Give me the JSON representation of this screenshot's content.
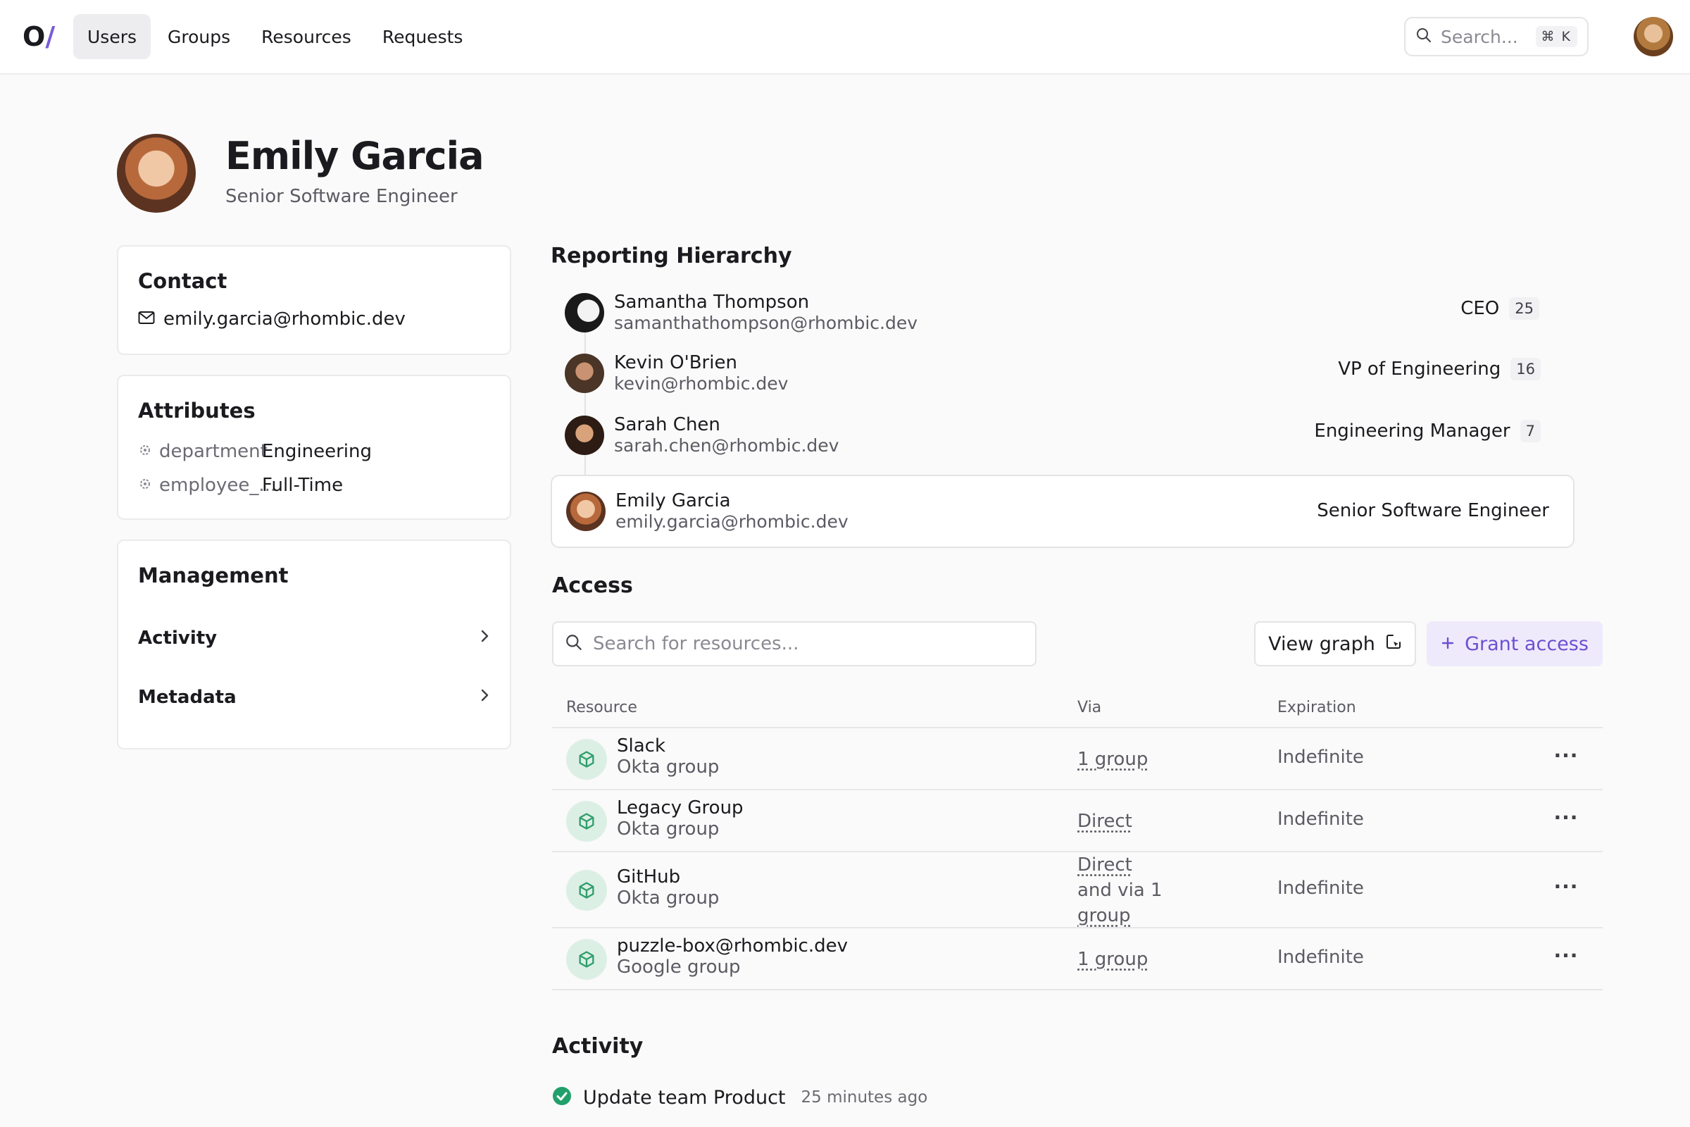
{
  "app": {
    "logo_o": "O",
    "logo_slash": "/"
  },
  "nav": {
    "items": [
      "Users",
      "Groups",
      "Resources",
      "Requests"
    ],
    "active": "Users"
  },
  "search": {
    "placeholder": "Search...",
    "shortcut": "⌘ K"
  },
  "profile": {
    "name": "Emily Garcia",
    "title": "Senior Software Engineer"
  },
  "contact": {
    "title": "Contact",
    "email": "emily.garcia@rhombic.dev"
  },
  "attributes": {
    "title": "Attributes",
    "items": [
      {
        "key": "department",
        "value": "Engineering"
      },
      {
        "key": "employee_...",
        "value": "Full-Time"
      }
    ]
  },
  "management": {
    "title": "Management",
    "items": [
      "Activity",
      "Metadata"
    ]
  },
  "hierarchy": {
    "title": "Reporting Hierarchy",
    "people": [
      {
        "name": "Samantha Thompson",
        "email": "samanthathompson@rhombic.dev",
        "role": "CEO",
        "count": "25"
      },
      {
        "name": "Kevin O'Brien",
        "email": "kevin@rhombic.dev",
        "role": "VP of Engineering",
        "count": "16"
      },
      {
        "name": "Sarah Chen",
        "email": "sarah.chen@rhombic.dev",
        "role": "Engineering Manager",
        "count": "7"
      },
      {
        "name": "Emily Garcia",
        "email": "emily.garcia@rhombic.dev",
        "role": "Senior Software Engineer",
        "count": ""
      }
    ]
  },
  "access": {
    "title": "Access",
    "search_placeholder": "Search for resources...",
    "view_graph_label": "View graph",
    "grant_label": "Grant access",
    "columns": {
      "resource": "Resource",
      "via": "Via",
      "expiration": "Expiration"
    },
    "rows": [
      {
        "name": "Slack",
        "type": "Okta group",
        "via": [
          "1 group"
        ],
        "expiration": "Indefinite"
      },
      {
        "name": "Legacy Group",
        "type": "Okta group",
        "via": [
          "Direct"
        ],
        "expiration": "Indefinite"
      },
      {
        "name": "GitHub",
        "type": "Okta group",
        "via": [
          "Direct",
          "and via 1",
          "group"
        ],
        "expiration": "Indefinite"
      },
      {
        "name": "puzzle-box@rhombic.dev",
        "type": "Google group",
        "via": [
          "1 group"
        ],
        "expiration": "Indefinite"
      }
    ],
    "more_label": "···"
  },
  "activity": {
    "title": "Activity",
    "items": [
      {
        "text": "Update team Product",
        "time": "25 minutes ago"
      }
    ]
  },
  "colors": {
    "accent": "#6d4fd1",
    "accent_bg": "#efeafb",
    "resource_icon": "#2f9e6b",
    "success": "#22a06b"
  }
}
